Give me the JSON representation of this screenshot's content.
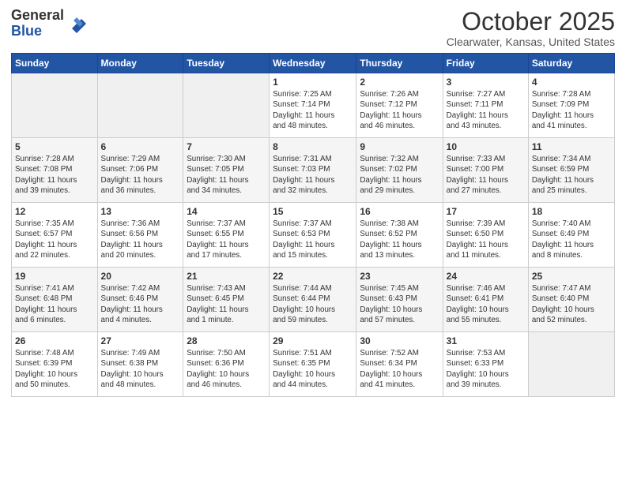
{
  "logo": {
    "general": "General",
    "blue": "Blue"
  },
  "title": "October 2025",
  "location": "Clearwater, Kansas, United States",
  "days_header": [
    "Sunday",
    "Monday",
    "Tuesday",
    "Wednesday",
    "Thursday",
    "Friday",
    "Saturday"
  ],
  "weeks": [
    [
      {
        "day": "",
        "info": ""
      },
      {
        "day": "",
        "info": ""
      },
      {
        "day": "",
        "info": ""
      },
      {
        "day": "1",
        "info": "Sunrise: 7:25 AM\nSunset: 7:14 PM\nDaylight: 11 hours\nand 48 minutes."
      },
      {
        "day": "2",
        "info": "Sunrise: 7:26 AM\nSunset: 7:12 PM\nDaylight: 11 hours\nand 46 minutes."
      },
      {
        "day": "3",
        "info": "Sunrise: 7:27 AM\nSunset: 7:11 PM\nDaylight: 11 hours\nand 43 minutes."
      },
      {
        "day": "4",
        "info": "Sunrise: 7:28 AM\nSunset: 7:09 PM\nDaylight: 11 hours\nand 41 minutes."
      }
    ],
    [
      {
        "day": "5",
        "info": "Sunrise: 7:28 AM\nSunset: 7:08 PM\nDaylight: 11 hours\nand 39 minutes."
      },
      {
        "day": "6",
        "info": "Sunrise: 7:29 AM\nSunset: 7:06 PM\nDaylight: 11 hours\nand 36 minutes."
      },
      {
        "day": "7",
        "info": "Sunrise: 7:30 AM\nSunset: 7:05 PM\nDaylight: 11 hours\nand 34 minutes."
      },
      {
        "day": "8",
        "info": "Sunrise: 7:31 AM\nSunset: 7:03 PM\nDaylight: 11 hours\nand 32 minutes."
      },
      {
        "day": "9",
        "info": "Sunrise: 7:32 AM\nSunset: 7:02 PM\nDaylight: 11 hours\nand 29 minutes."
      },
      {
        "day": "10",
        "info": "Sunrise: 7:33 AM\nSunset: 7:00 PM\nDaylight: 11 hours\nand 27 minutes."
      },
      {
        "day": "11",
        "info": "Sunrise: 7:34 AM\nSunset: 6:59 PM\nDaylight: 11 hours\nand 25 minutes."
      }
    ],
    [
      {
        "day": "12",
        "info": "Sunrise: 7:35 AM\nSunset: 6:57 PM\nDaylight: 11 hours\nand 22 minutes."
      },
      {
        "day": "13",
        "info": "Sunrise: 7:36 AM\nSunset: 6:56 PM\nDaylight: 11 hours\nand 20 minutes."
      },
      {
        "day": "14",
        "info": "Sunrise: 7:37 AM\nSunset: 6:55 PM\nDaylight: 11 hours\nand 17 minutes."
      },
      {
        "day": "15",
        "info": "Sunrise: 7:37 AM\nSunset: 6:53 PM\nDaylight: 11 hours\nand 15 minutes."
      },
      {
        "day": "16",
        "info": "Sunrise: 7:38 AM\nSunset: 6:52 PM\nDaylight: 11 hours\nand 13 minutes."
      },
      {
        "day": "17",
        "info": "Sunrise: 7:39 AM\nSunset: 6:50 PM\nDaylight: 11 hours\nand 11 minutes."
      },
      {
        "day": "18",
        "info": "Sunrise: 7:40 AM\nSunset: 6:49 PM\nDaylight: 11 hours\nand 8 minutes."
      }
    ],
    [
      {
        "day": "19",
        "info": "Sunrise: 7:41 AM\nSunset: 6:48 PM\nDaylight: 11 hours\nand 6 minutes."
      },
      {
        "day": "20",
        "info": "Sunrise: 7:42 AM\nSunset: 6:46 PM\nDaylight: 11 hours\nand 4 minutes."
      },
      {
        "day": "21",
        "info": "Sunrise: 7:43 AM\nSunset: 6:45 PM\nDaylight: 11 hours\nand 1 minute."
      },
      {
        "day": "22",
        "info": "Sunrise: 7:44 AM\nSunset: 6:44 PM\nDaylight: 10 hours\nand 59 minutes."
      },
      {
        "day": "23",
        "info": "Sunrise: 7:45 AM\nSunset: 6:43 PM\nDaylight: 10 hours\nand 57 minutes."
      },
      {
        "day": "24",
        "info": "Sunrise: 7:46 AM\nSunset: 6:41 PM\nDaylight: 10 hours\nand 55 minutes."
      },
      {
        "day": "25",
        "info": "Sunrise: 7:47 AM\nSunset: 6:40 PM\nDaylight: 10 hours\nand 52 minutes."
      }
    ],
    [
      {
        "day": "26",
        "info": "Sunrise: 7:48 AM\nSunset: 6:39 PM\nDaylight: 10 hours\nand 50 minutes."
      },
      {
        "day": "27",
        "info": "Sunrise: 7:49 AM\nSunset: 6:38 PM\nDaylight: 10 hours\nand 48 minutes."
      },
      {
        "day": "28",
        "info": "Sunrise: 7:50 AM\nSunset: 6:36 PM\nDaylight: 10 hours\nand 46 minutes."
      },
      {
        "day": "29",
        "info": "Sunrise: 7:51 AM\nSunset: 6:35 PM\nDaylight: 10 hours\nand 44 minutes."
      },
      {
        "day": "30",
        "info": "Sunrise: 7:52 AM\nSunset: 6:34 PM\nDaylight: 10 hours\nand 41 minutes."
      },
      {
        "day": "31",
        "info": "Sunrise: 7:53 AM\nSunset: 6:33 PM\nDaylight: 10 hours\nand 39 minutes."
      },
      {
        "day": "",
        "info": ""
      }
    ]
  ]
}
